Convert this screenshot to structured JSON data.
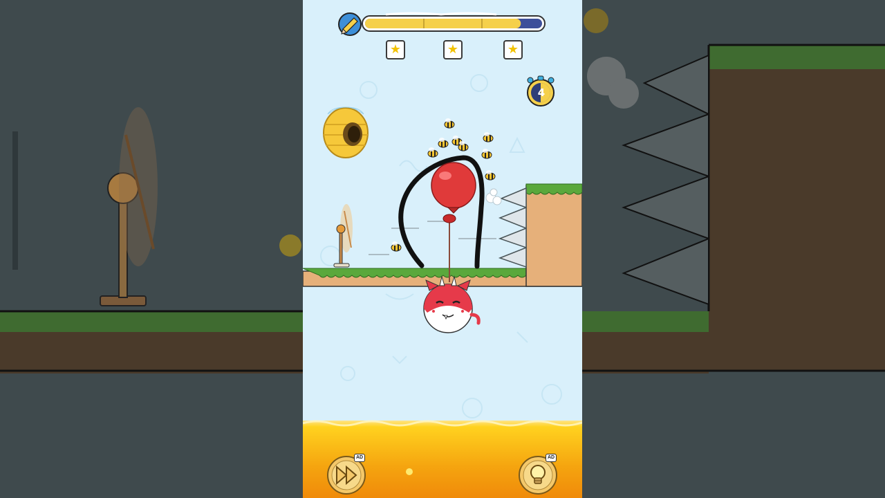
{
  "hud": {
    "ink_meter_level": 0.88,
    "stars_earned": 3,
    "stars": [
      "★",
      "★",
      "★"
    ],
    "timer_value": "4"
  },
  "buttons": {
    "skip_badge": "AD",
    "hint_badge": "AD"
  },
  "colors": {
    "sky": "#d9f0fb",
    "ink_meter_fill": "#f5d04a",
    "ink_meter_empty": "#3d4f9a",
    "grass": "#5aa83c",
    "dirt": "#e6b07a",
    "lava_top": "#ffd21f",
    "lava_bottom": "#f08a0a",
    "balloon": "#e03a3a",
    "character": "#e63a4a"
  },
  "icons": {
    "ink_meter": "pencil-icon",
    "timer": "stopwatch-icon",
    "skip": "fast-forward-icon",
    "hint": "lightbulb-icon"
  }
}
